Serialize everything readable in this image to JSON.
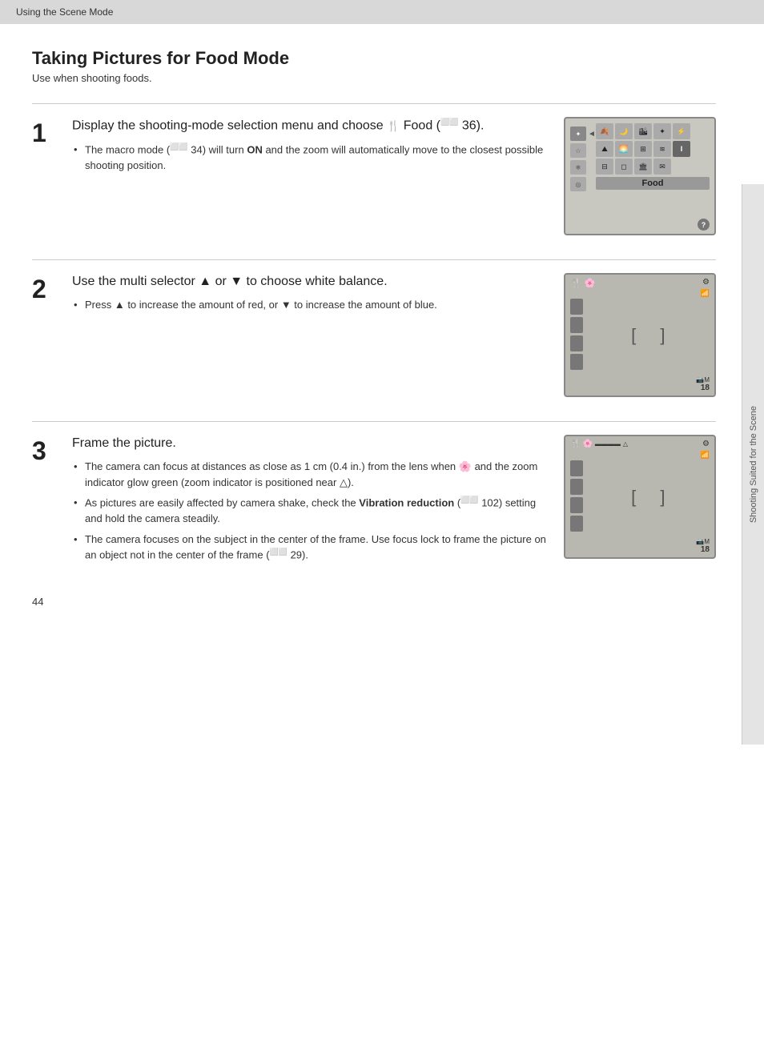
{
  "header": {
    "title": "Using the Scene Mode"
  },
  "page": {
    "title": "Taking Pictures for Food Mode",
    "subtitle": "Use when shooting foods.",
    "page_number": "44",
    "sidebar_label": "Shooting Suited for the Scene"
  },
  "steps": [
    {
      "number": "1",
      "heading": "Display the shooting-mode selection menu and choose ▓▓ Food (□□ 36).",
      "heading_plain": "Display the shooting-mode selection menu and choose ",
      "heading_icon": "🍴",
      "heading_end": " Food (  36).",
      "bullets": [
        "The macro mode (  34) will turn ON and the zoom will automatically move to the closest possible shooting position."
      ]
    },
    {
      "number": "2",
      "heading": "Use the multi selector ▲ or ▼ to choose white balance.",
      "bullets": [
        "Press ▲ to increase the amount of red, or ▼ to increase the amount of blue."
      ]
    },
    {
      "number": "3",
      "heading": "Frame the picture.",
      "bullets": [
        "The camera can focus at distances as close as 1 cm (0.4 in.) from the lens when 🌸 and the zoom indicator glow green (zoom indicator is positioned near △).",
        "As pictures are easily affected by camera shake, check the Vibration reduction (  102) setting and hold the camera steadily.",
        "The camera focuses on the subject in the center of the frame. Use focus lock to frame the picture on an object not in the center of the frame (  29)."
      ],
      "vibration_reduction_bold": "Vibration reduction"
    }
  ]
}
